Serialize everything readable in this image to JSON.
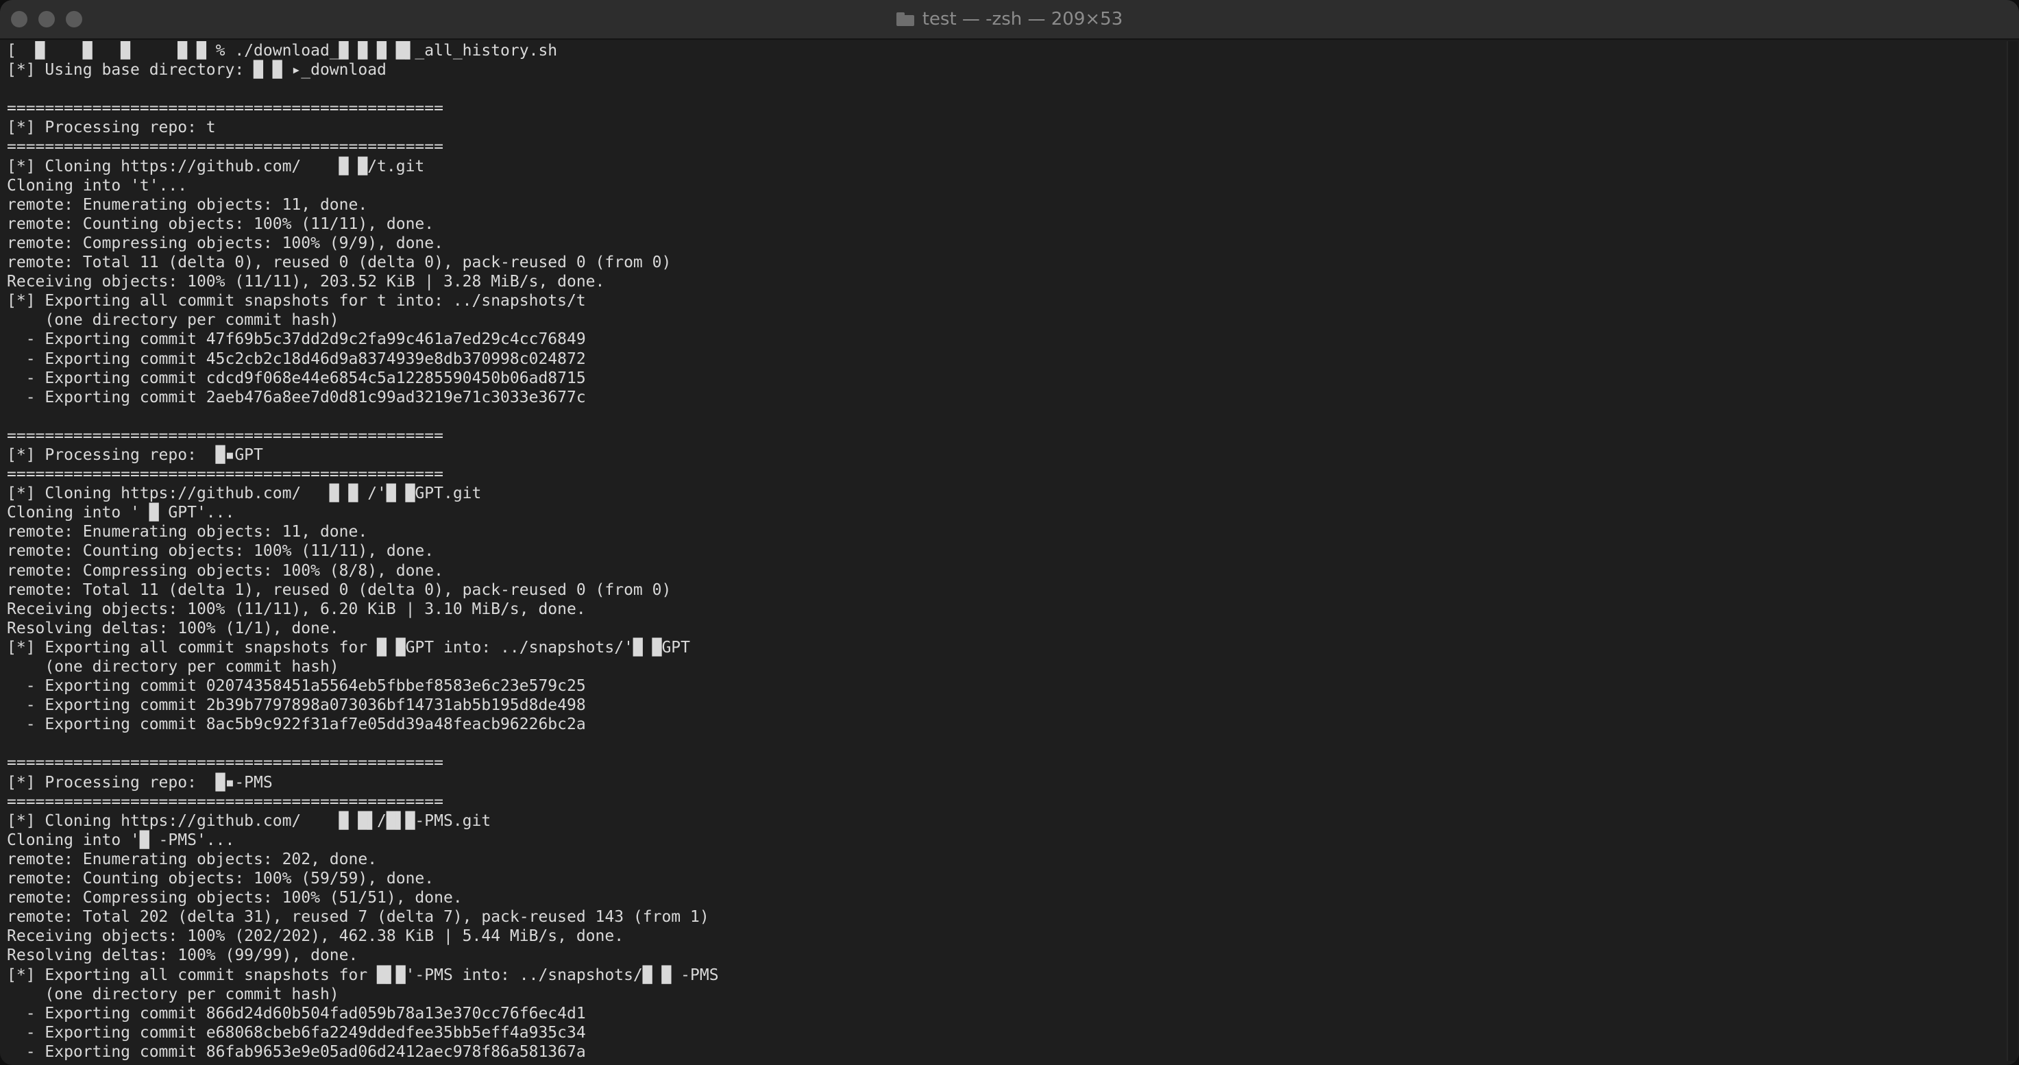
{
  "window": {
    "title": "test — -zsh — 209×53"
  },
  "terminal": {
    "lines": [
      "[  █    █   █     █ █ % ./download_█ █ █ █▌_all_history.sh",
      "[*] Using base directory: █ █ ▸_download",
      "",
      "==============================================",
      "[*] Processing repo: t",
      "==============================================",
      "[*] Cloning https://github.com/    █ █/t.git",
      "Cloning into 't'...",
      "remote: Enumerating objects: 11, done.",
      "remote: Counting objects: 100% (11/11), done.",
      "remote: Compressing objects: 100% (9/9), done.",
      "remote: Total 11 (delta 0), reused 0 (delta 0), pack-reused 0 (from 0)",
      "Receiving objects: 100% (11/11), 203.52 KiB | 3.28 MiB/s, done.",
      "[*] Exporting all commit snapshots for t into: ../snapshots/t",
      "    (one directory per commit hash)",
      "  - Exporting commit 47f69b5c37dd2d9c2fa99c461a7ed29c4cc76849",
      "  - Exporting commit 45c2cb2c18d46d9a8374939e8db370998c024872",
      "  - Exporting commit cdcd9f068e44e6854c5a12285590450b06ad8715",
      "  - Exporting commit 2aeb476a8ee7d0d81c99ad3219e71c3033e3677c",
      "",
      "==============================================",
      "[*] Processing repo:  █▪GPT",
      "==============================================",
      "[*] Cloning https://github.com/   █ █ /'█ █GPT.git",
      "Cloning into ' █ GPT'...",
      "remote: Enumerating objects: 11, done.",
      "remote: Counting objects: 100% (11/11), done.",
      "remote: Compressing objects: 100% (8/8), done.",
      "remote: Total 11 (delta 1), reused 0 (delta 0), pack-reused 0 (from 0)",
      "Receiving objects: 100% (11/11), 6.20 KiB | 3.10 MiB/s, done.",
      "Resolving deltas: 100% (1/1), done.",
      "[*] Exporting all commit snapshots for █ █GPT into: ../snapshots/'█ █GPT",
      "    (one directory per commit hash)",
      "  - Exporting commit 02074358451a5564eb5fbbef8583e6c23e579c25",
      "  - Exporting commit 2b39b7797898a073036bf14731ab5b195d8de498",
      "  - Exporting commit 8ac5b9c922f31af7e05dd39a48feacb96226bc2a",
      "",
      "==============================================",
      "[*] Processing repo:  █▪-PMS",
      "==============================================",
      "[*] Cloning https://github.com/    █ █▌/█▌█-PMS.git",
      "Cloning into '█ -PMS'...",
      "remote: Enumerating objects: 202, done.",
      "remote: Counting objects: 100% (59/59), done.",
      "remote: Compressing objects: 100% (51/51), done.",
      "remote: Total 202 (delta 31), reused 7 (delta 7), pack-reused 143 (from 1)",
      "Receiving objects: 100% (202/202), 462.38 KiB | 5.44 MiB/s, done.",
      "Resolving deltas: 100% (99/99), done.",
      "[*] Exporting all commit snapshots for █▌█'-PMS into: ../snapshots/█ █ -PMS",
      "    (one directory per commit hash)",
      "  - Exporting commit 866d24d60b504fad059b78a13e370cc76f6ec4d1",
      "  - Exporting commit e68068cbeb6fa2249ddedfee35bb5eff4a935c34",
      "  - Exporting commit 86fab9653e9e05ad06d2412aec978f86a581367a"
    ]
  }
}
